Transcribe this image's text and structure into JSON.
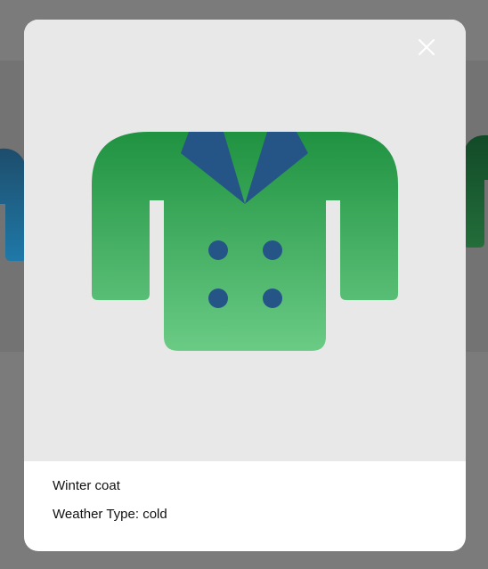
{
  "item": {
    "name": "Winter coat",
    "weather_label": "Weather Type:",
    "weather_value": "cold",
    "image_icon": "winter-coat-icon"
  },
  "close_icon": "close-icon",
  "colors": {
    "overlay": "#7b7b7b",
    "preview_bg": "#e8e8e8",
    "coat_green_top": "#1f9240",
    "coat_green_bottom": "#6acb85",
    "lapel_blue": "#255587",
    "button_blue": "#255587"
  }
}
